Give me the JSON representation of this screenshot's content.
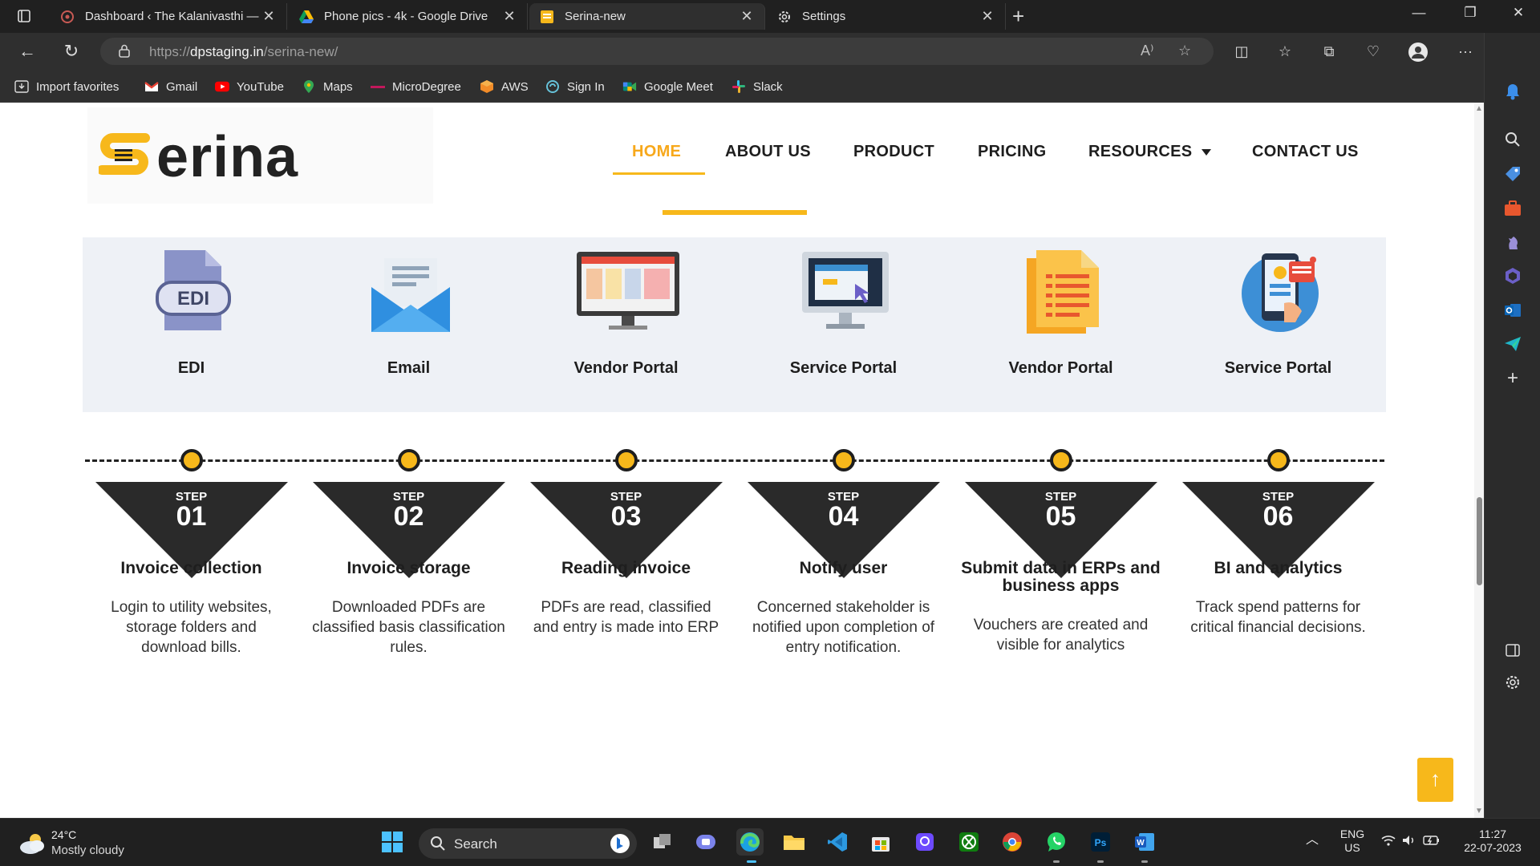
{
  "browser": {
    "tabs": [
      {
        "title": "Dashboard ‹ The Kalanivasthi — ",
        "icon": "wordpress-icon",
        "active": false
      },
      {
        "title": "Phone pics - 4k - Google Drive",
        "icon": "google-drive-icon",
        "active": false
      },
      {
        "title": "Serina-new",
        "icon": "serina-favicon",
        "active": true
      },
      {
        "title": "Settings",
        "icon": "gear-icon",
        "active": false
      }
    ],
    "url_prefix": "https://",
    "url_host": "dpstaging.in",
    "url_path": "/serina-new/",
    "bookmarks": [
      {
        "label": "Import favorites",
        "icon": "import-icon"
      },
      {
        "label": "Gmail",
        "icon": "gmail-icon"
      },
      {
        "label": "YouTube",
        "icon": "youtube-icon"
      },
      {
        "label": "Maps",
        "icon": "maps-icon"
      },
      {
        "label": "MicroDegree",
        "icon": "microdegree-icon"
      },
      {
        "label": "AWS",
        "icon": "aws-icon"
      },
      {
        "label": "Sign In",
        "icon": "signin-icon"
      },
      {
        "label": "Google Meet",
        "icon": "google-meet-icon"
      },
      {
        "label": "Slack",
        "icon": "slack-icon"
      }
    ]
  },
  "site": {
    "logo_text": "erina",
    "logo_s": "S",
    "nav": [
      {
        "label": "HOME",
        "active": true
      },
      {
        "label": "ABOUT US",
        "active": false
      },
      {
        "label": "PRODUCT",
        "active": false
      },
      {
        "label": "PRICING",
        "active": false
      },
      {
        "label": "RESOURCES",
        "active": false
      },
      {
        "label": "CONTACT US",
        "active": false
      }
    ],
    "channels": [
      {
        "label": "EDI",
        "icon": "edi-file-icon",
        "icon_text": "EDI"
      },
      {
        "label": "Email",
        "icon": "envelope-icon"
      },
      {
        "label": "Vendor Portal",
        "icon": "monitor-dashboard-icon"
      },
      {
        "label": "Service Portal",
        "icon": "monitor-cursor-icon"
      },
      {
        "label": "Vendor Portal",
        "icon": "document-list-icon"
      },
      {
        "label": "Service Portal",
        "icon": "mobile-analytics-icon"
      }
    ],
    "step_label": "STEP",
    "steps": [
      {
        "num": "01",
        "title": "Invoice collection",
        "desc": "Login to utility websites, storage folders and download bills."
      },
      {
        "num": "02",
        "title": "Invoice storage",
        "desc": "Downloaded PDFs are classified basis classification rules."
      },
      {
        "num": "03",
        "title": "Reading invoice",
        "desc": "PDFs are read, classified and entry is made into ERP"
      },
      {
        "num": "04",
        "title": "Notify user",
        "desc": "Concerned stakeholder is notified upon completion of entry notification."
      },
      {
        "num": "05",
        "title": "Submit data in ERPs and business apps",
        "desc": "Vouchers are created and visible for analytics"
      },
      {
        "num": "06",
        "title": "BI and analytics",
        "desc": "Track spend patterns for critical financial decisions."
      }
    ],
    "back_to_top": "↑"
  },
  "taskbar": {
    "weather_temp": "24°C",
    "weather_cond": "Mostly cloudy",
    "search_label": "Search",
    "lang_top": "ENG",
    "lang_bottom": "US",
    "time": "11:27",
    "date": "22-07-2023"
  },
  "colors": {
    "brand_yellow": "#f7b81b",
    "dark": "#1e1e1e",
    "channel_bg": "#eef1f6"
  }
}
